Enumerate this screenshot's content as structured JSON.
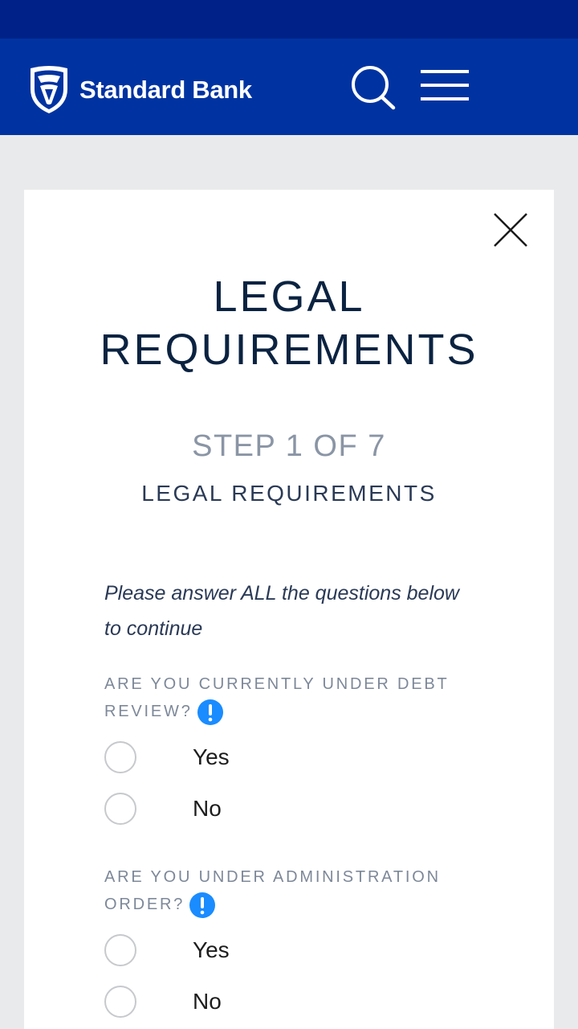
{
  "header": {
    "brand_name": "Standard Bank",
    "logo_icon": "standard-bank-shield-logo",
    "search_icon": "search-icon",
    "menu_icon": "hamburger-menu-icon",
    "colors": {
      "status_bar": "#002288",
      "header": "#0033a1"
    }
  },
  "dialog": {
    "close_icon": "close-icon",
    "title_line1": "LEGAL",
    "title_line2": "REQUIREMENTS",
    "step": "STEP 1 OF 7",
    "subtitle": "LEGAL REQUIREMENTS",
    "intro": "Please answer ALL the questions below to continue",
    "questions": [
      {
        "label": "ARE YOU CURRENTLY UNDER DEBT REVIEW?",
        "info_icon": "info-exclamation-icon",
        "options": [
          {
            "label": "Yes",
            "selected": false
          },
          {
            "label": "No",
            "selected": false
          }
        ]
      },
      {
        "label": "ARE YOU UNDER ADMINISTRATION ORDER?",
        "info_icon": "info-exclamation-icon",
        "options": [
          {
            "label": "Yes",
            "selected": false
          },
          {
            "label": "No",
            "selected": false
          }
        ]
      }
    ],
    "colors": {
      "info_icon": "#1a8cff",
      "title": "#0b2341"
    }
  }
}
